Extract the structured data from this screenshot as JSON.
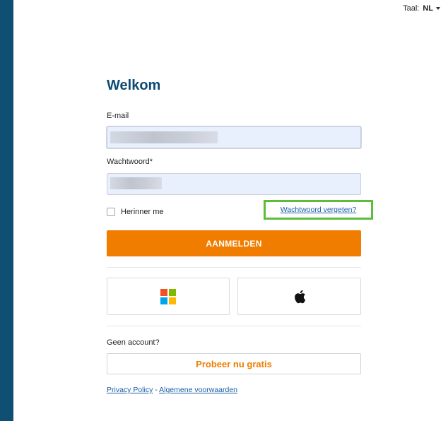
{
  "colors": {
    "sidebar": "#0e4f73",
    "title": "#0d4a73",
    "accent_orange": "#f07d00",
    "link_blue": "#1a5fa8",
    "highlight_green": "#5bbd3a"
  },
  "language": {
    "label": "Taal:",
    "value": "NL"
  },
  "login": {
    "title": "Welkom",
    "email_label": "E-mail",
    "password_label": "Wachtwoord*",
    "remember_me": "Herinner me",
    "forgot_password": "Wachtwoord vergeten?",
    "submit": "AANMELDEN"
  },
  "sso": {
    "microsoft_icon": "microsoft-logo",
    "apple_icon": "apple-logo"
  },
  "signup": {
    "prompt": "Geen account?",
    "trial_button": "Probeer nu gratis"
  },
  "footer": {
    "privacy": "Privacy Policy",
    "separator": " - ",
    "terms": "Algemene voorwaarden"
  }
}
